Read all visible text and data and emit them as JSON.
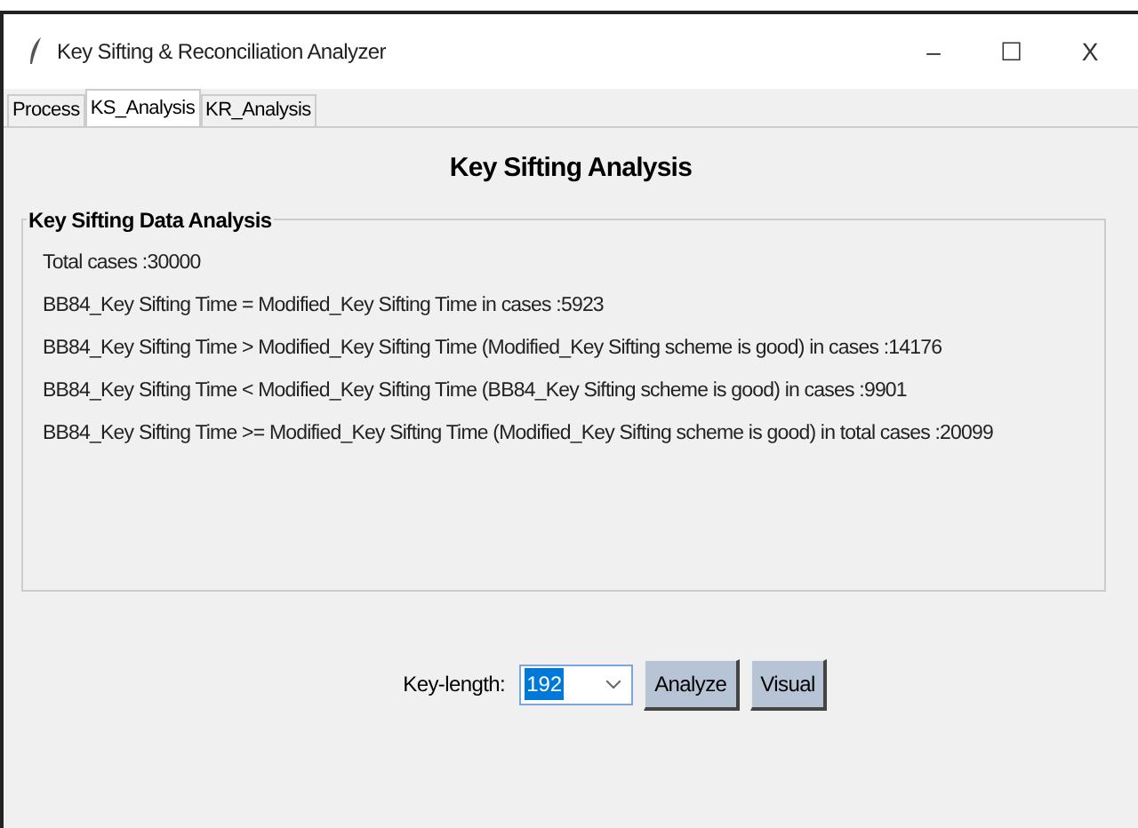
{
  "window": {
    "title": "Key Sifting & Reconciliation Analyzer",
    "controls": [
      "–",
      "☐",
      "X"
    ]
  },
  "tabs": [
    {
      "label": "Process",
      "selected": false
    },
    {
      "label": "KS_Analysis",
      "selected": true
    },
    {
      "label": "KR_Analysis",
      "selected": false
    }
  ],
  "heading": "Key Sifting Analysis",
  "group": {
    "title": "Key Sifting Data Analysis",
    "lines": [
      "Total cases :30000",
      "BB84_Key Sifting Time = Modified_Key Sifting Time in cases :5923",
      "BB84_Key Sifting Time > Modified_Key Sifting Time (Modified_Key Sifting scheme is good) in cases :14176",
      "BB84_Key Sifting Time < Modified_Key Sifting Time (BB84_Key Sifting scheme is good) in cases :9901",
      "BB84_Key Sifting Time >= Modified_Key Sifting Time (Modified_Key Sifting scheme is good) in total cases :20099"
    ]
  },
  "controls": {
    "key_length_label": "Key-length:",
    "key_length_value": "192",
    "buttons": [
      "Analyze",
      "Visual"
    ]
  }
}
